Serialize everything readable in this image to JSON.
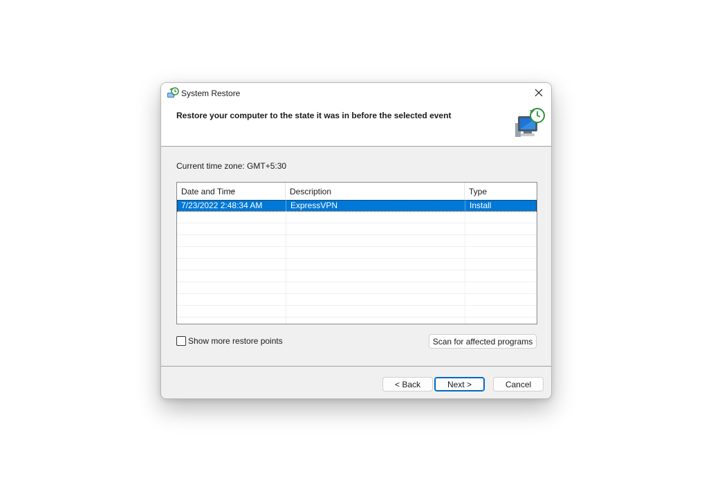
{
  "window": {
    "title": "System Restore",
    "close_label": "×"
  },
  "header": {
    "heading": "Restore your computer to the state it was in before the selected event"
  },
  "timezone": {
    "label": "Current time zone: GMT+5:30"
  },
  "table": {
    "columns": [
      "Date and Time",
      "Description",
      "Type"
    ],
    "sorted_column": "Date and Time",
    "rows": [
      {
        "date": "7/23/2022 2:48:34 AM",
        "description": "ExpressVPN",
        "type": "Install",
        "selected": true
      }
    ],
    "selection_color": "#0078d7"
  },
  "options": {
    "show_more_label": "Show more restore points",
    "show_more_checked": false,
    "scan_button": "Scan for affected programs"
  },
  "footer": {
    "back_button": "< Back",
    "next_button": "Next >",
    "cancel_button": "Cancel"
  },
  "icons": {
    "title": "system-restore-icon",
    "hero": "computer-restore-icon",
    "close": "close-icon",
    "sort": "sort-chevron-icon"
  },
  "colors": {
    "accent": "#0067c0",
    "window_bg": "#f0f0f0",
    "header_bg": "#ffffff"
  }
}
